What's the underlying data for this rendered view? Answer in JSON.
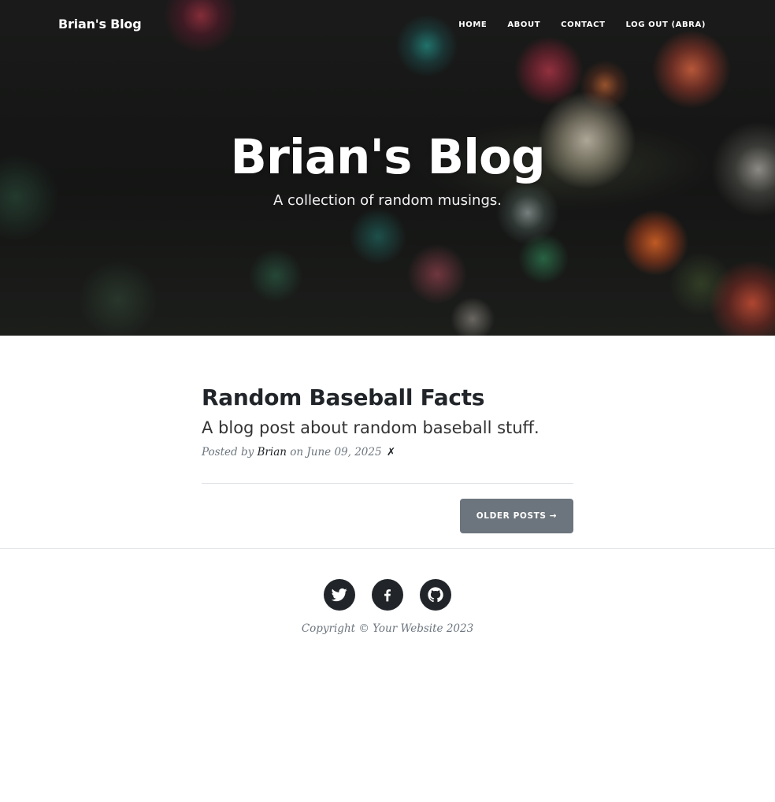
{
  "navbar": {
    "brand": "Brian's Blog",
    "items": [
      {
        "label": "HOME"
      },
      {
        "label": "ABOUT"
      },
      {
        "label": "CONTACT"
      },
      {
        "label": "LOG OUT (ABRA)"
      }
    ]
  },
  "header": {
    "title": "Brian's Blog",
    "subtitle": "A collection of random musings."
  },
  "posts": [
    {
      "title": "Random Baseball Facts",
      "subtitle": "A blog post about random baseball stuff.",
      "posted_by_prefix": "Posted by",
      "author": "Brian",
      "date_text": "on June 09, 2025",
      "delete_mark": "✗"
    }
  ],
  "pager": {
    "older_label": "OLDER POSTS →"
  },
  "footer": {
    "social_icons": [
      "twitter-icon",
      "facebook-icon",
      "github-icon"
    ],
    "copyright": "Copyright © Your Website 2023"
  }
}
